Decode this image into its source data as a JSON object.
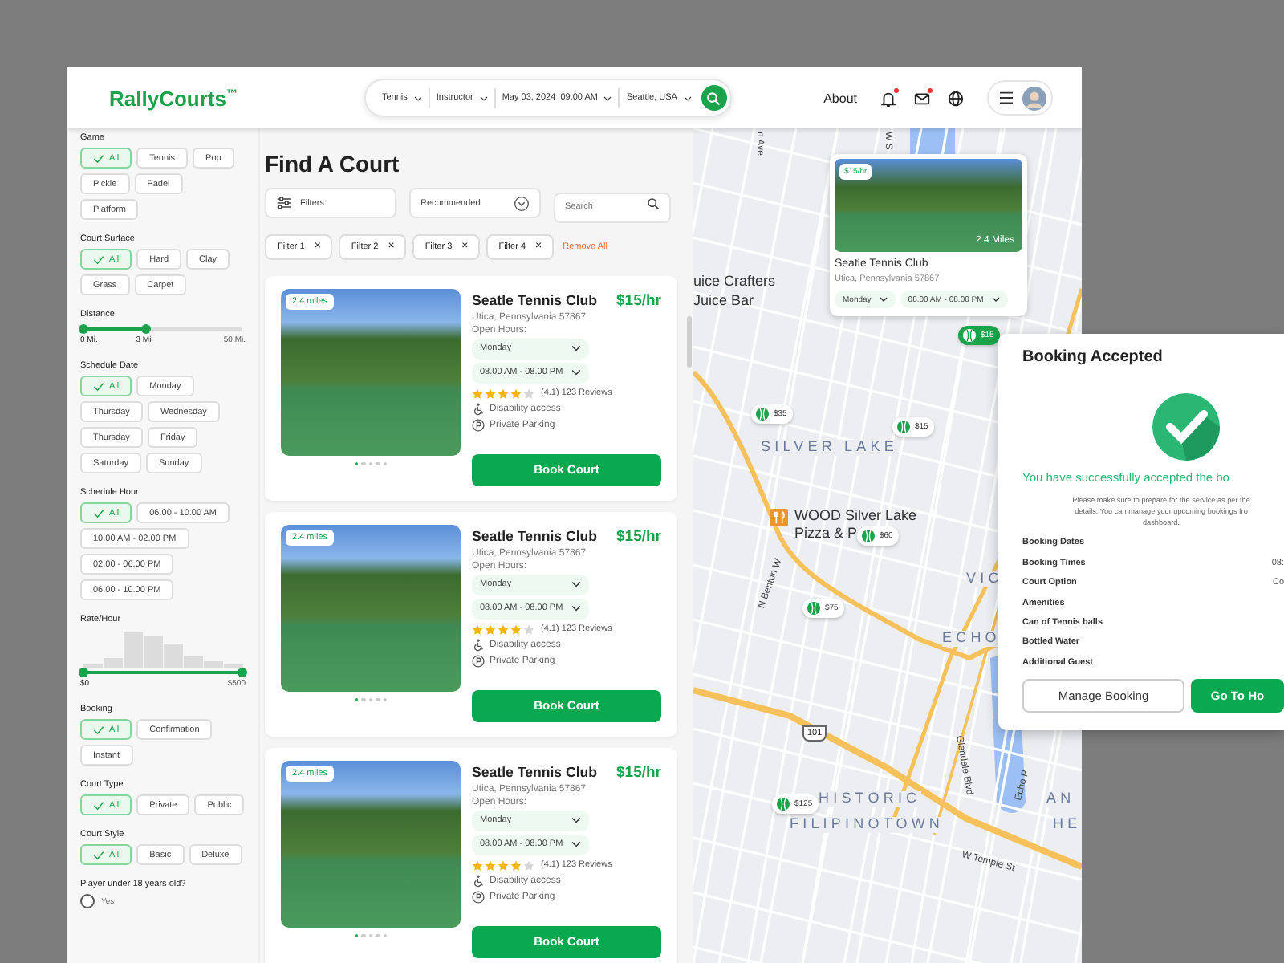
{
  "header": {
    "logo": "RallyCourts$^{™}$",
    "search_segments": [
      {
        "label": "Tennis"
      },
      {
        "label": "Instructor"
      },
      {
        "label": "May 03, 2024  09.00 AM"
      },
      {
        "label": "Seattle, USA"
      }
    ],
    "nav_link": "About",
    "nav_icons": [
      {
        "kind": "bell",
        "unread": true
      },
      {
        "kind": "mail",
        "unread": true
      },
      {
        "kind": "globe",
        "unread": false
      }
    ]
  },
  "filters": [
    {
      "kind": "chips",
      "title": "Game",
      "chips": [
        {
          "label": "All",
          "selected": true
        },
        {
          "label": "Tennis",
          "selected": false
        },
        {
          "label": "Pop",
          "selected": false
        },
        {
          "label": "Pickle",
          "selected": false
        },
        {
          "label": "Padel",
          "selected": false
        },
        {
          "label": "Platform",
          "selected": false
        }
      ]
    },
    {
      "kind": "chips",
      "title": "Court Surface",
      "chips": [
        {
          "label": "All",
          "selected": true
        },
        {
          "label": "Hard",
          "selected": false
        },
        {
          "label": "Clay",
          "selected": false
        },
        {
          "label": "Grass",
          "selected": false
        },
        {
          "label": "Carpet",
          "selected": false
        }
      ]
    },
    {
      "kind": "range",
      "title": "Distance",
      "level": 0.39,
      "labels": [
        "0 Mi.",
        "3 Mi.",
        "50 Mi."
      ]
    },
    {
      "kind": "chips",
      "title": "Schedule Date",
      "chips": [
        {
          "label": "All",
          "selected": true
        },
        {
          "label": "Monday",
          "selected": false
        },
        {
          "label": "Thursday",
          "selected": false
        },
        {
          "label": "Wednesday",
          "selected": false
        },
        {
          "label": "Thursday",
          "selected": false
        },
        {
          "label": "Friday",
          "selected": false
        },
        {
          "label": "Saturday",
          "selected": false
        },
        {
          "label": "Sunday",
          "selected": false
        }
      ]
    },
    {
      "kind": "chips",
      "title": "Schedule Hour",
      "chips": [
        {
          "label": "All",
          "selected": true
        },
        {
          "label": "06.00 - 10.00 AM",
          "selected": false
        },
        {
          "label": "10.00 AM - 02.00 PM",
          "selected": false
        },
        {
          "label": "02.00 - 06.00 PM",
          "selected": false
        },
        {
          "label": "06.00 - 10.00 PM",
          "selected": false
        }
      ]
    },
    {
      "kind": "histogram",
      "title": "Rate/Hour",
      "level": 1,
      "labels": [
        "$0",
        "$500"
      ]
    },
    {
      "kind": "chips",
      "title": "Booking",
      "chips": [
        {
          "label": "All",
          "selected": true
        },
        {
          "label": "Confirmation",
          "selected": false
        },
        {
          "label": "Instant",
          "selected": false
        }
      ]
    },
    {
      "kind": "chips",
      "title": "Court Type",
      "chips": [
        {
          "label": "All",
          "selected": true
        },
        {
          "label": "Private",
          "selected": false
        },
        {
          "label": "Public",
          "selected": false
        }
      ]
    },
    {
      "kind": "chips",
      "title": "Court Style",
      "chips": [
        {
          "label": "All",
          "selected": true
        },
        {
          "label": "Basic",
          "selected": false
        },
        {
          "label": "Deluxe",
          "selected": false
        }
      ]
    },
    {
      "kind": "radio",
      "title": "Player under 18 years old?",
      "options": [
        {
          "label": "Yes",
          "selected": false
        }
      ]
    }
  ],
  "results": {
    "title": "Find A Court",
    "filter_button": "Filters",
    "sort": "Recommended",
    "search": {
      "placeholder": "Search"
    },
    "active_filters": [
      {
        "label": "Filter 1",
        "remove": "×"
      },
      {
        "label": "Filter 2",
        "remove": "×"
      },
      {
        "label": "Filter 3",
        "remove": "×"
      },
      {
        "label": "Filter 4",
        "remove": "×"
      }
    ],
    "clear": "Remove All",
    "courts": [
      {
        "distance": "2.4 miles",
        "name": "Seatle Tennis Club",
        "price": "$15/hr",
        "address": "Utica, Pennsylvania 57867",
        "hours_label": "Open Hours:",
        "day": "Monday",
        "hours": "08.00 AM - 08.00 PM",
        "stars": 4,
        "rating": "(4.1) 123 Reviews",
        "amenities": [
          {
            "kind": "accessibility",
            "label": "Disability access"
          },
          {
            "kind": "parking",
            "label": "Private Parking"
          }
        ],
        "dots": [
          {
            "selected": true
          },
          {
            "selected": false
          },
          {
            "selected": false
          },
          {
            "selected": false
          },
          {
            "selected": false
          }
        ],
        "button": "Book Court"
      },
      {
        "distance": "2.4 miles",
        "name": "Seatle Tennis Club",
        "price": "$15/hr",
        "address": "Utica, Pennsylvania 57867",
        "hours_label": "Open Hours:",
        "day": "Monday",
        "hours": "08.00 AM - 08.00 PM",
        "stars": 4,
        "rating": "(4.1) 123 Reviews",
        "amenities": [
          {
            "kind": "accessibility",
            "label": "Disability access"
          },
          {
            "kind": "parking",
            "label": "Private Parking"
          }
        ],
        "dots": [
          {
            "selected": true
          },
          {
            "selected": false
          },
          {
            "selected": false
          },
          {
            "selected": false
          },
          {
            "selected": false
          }
        ],
        "button": "Book Court"
      },
      {
        "distance": "2.4 miles",
        "name": "Seatle Tennis Club",
        "price": "$15/hr",
        "address": "Utica, Pennsylvania 57867",
        "hours_label": "Open Hours:",
        "day": "Monday",
        "hours": "08.00 AM - 08.00 PM",
        "stars": 4,
        "rating": "(4.1) 123 Reviews",
        "amenities": [
          {
            "kind": "accessibility",
            "label": "Disability access"
          },
          {
            "kind": "parking",
            "label": "Private Parking"
          }
        ],
        "dots": [
          {
            "selected": true
          },
          {
            "selected": false
          },
          {
            "selected": false
          },
          {
            "selected": false
          },
          {
            "selected": false
          }
        ],
        "button": "Book Court"
      }
    ]
  },
  "map": {
    "labels": [
      {
        "kind": "street",
        "text": "n Ave"
      },
      {
        "kind": "street",
        "text": "W S"
      },
      {
        "kind": "poi",
        "text": "uice Crafters"
      },
      {
        "kind": "poi",
        "text": "Juice Bar"
      },
      {
        "kind": "area",
        "text": "SILVER LAKE"
      },
      {
        "kind": "poi",
        "text": "WOOD Silver Lake"
      },
      {
        "kind": "poi",
        "text": "Pizza & P"
      },
      {
        "kind": "area",
        "text": "VIC"
      },
      {
        "kind": "area",
        "text": "ECHO"
      },
      {
        "kind": "street",
        "text": "N Benton W"
      },
      {
        "kind": "street",
        "text": "Glendale Blvd"
      },
      {
        "kind": "street",
        "text": "Echo P"
      },
      {
        "kind": "area",
        "text": "HISTORIC"
      },
      {
        "kind": "area",
        "text": "FILIPINOTOWN"
      },
      {
        "kind": "area",
        "text": "AN"
      },
      {
        "kind": "area",
        "text": "HE"
      },
      {
        "kind": "street",
        "text": "W Temple St"
      }
    ],
    "shield": "101",
    "pins": [
      {
        "price": "$15",
        "selected": true
      },
      {
        "price": "$35",
        "selected": false
      },
      {
        "price": "$15",
        "selected": false
      },
      {
        "price": "$60",
        "selected": false
      },
      {
        "price": "$75",
        "selected": false
      },
      {
        "price": "$125",
        "selected": false
      }
    ],
    "card": {
      "price": "$15/hr",
      "distance": "2.4 Miles",
      "name": "Seatle Tennis Club",
      "address": "Utica, Pennsylvania 57867",
      "day": "Monday",
      "hours": "08.00 AM - 08.00 PM"
    }
  },
  "modal": {
    "title": "Booking Accepted",
    "message": "You have successfully accepted the bo",
    "note": [
      "Please make sure to prepare for the service as per the",
      "details. You can manage your upcoming bookings fro",
      "dashboard."
    ],
    "details": [
      {
        "label": "Booking Dates"
      },
      {
        "label": "Booking Times",
        "value": "08:"
      },
      {
        "label": "Court Option",
        "value": "Co"
      },
      {
        "label": "Amenities"
      },
      {
        "label": "Can of Tennis balls"
      },
      {
        "label": "Bottled Water"
      },
      {
        "label": "Additional Guest"
      }
    ],
    "buttons": [
      {
        "kind": "secondary",
        "label": "Manage Booking"
      },
      {
        "kind": "primary",
        "label": "Go To Ho"
      }
    ]
  }
}
